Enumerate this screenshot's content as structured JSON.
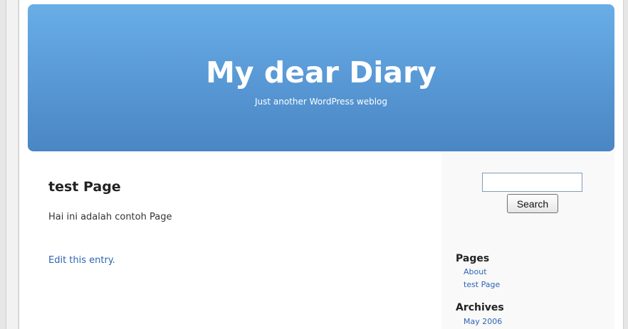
{
  "header": {
    "site_title": "My dear Diary",
    "tagline": "Just another WordPress weblog"
  },
  "content": {
    "title": "test Page",
    "body": "Hai ini adalah contoh Page",
    "edit_link": "Edit this entry."
  },
  "sidebar": {
    "search": {
      "value": "",
      "button_label": "Search"
    },
    "pages": {
      "heading": "Pages",
      "items": [
        "About",
        "test Page"
      ]
    },
    "archives": {
      "heading": "Archives",
      "items": [
        "May 2006"
      ]
    }
  },
  "colors": {
    "header_top": "#69aee7",
    "header_bottom": "#4a86c3",
    "link": "#2f64b4"
  }
}
